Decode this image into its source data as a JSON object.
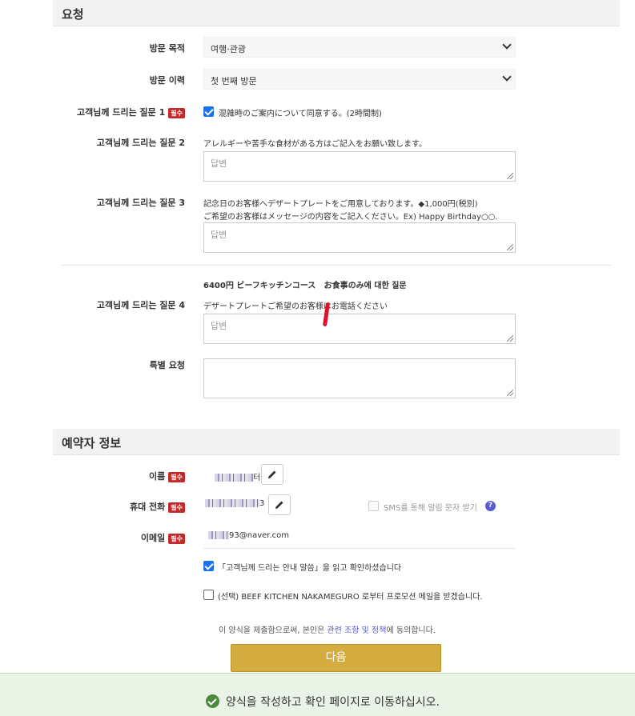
{
  "request_section": {
    "title": "요청",
    "visit_purpose": {
      "label": "방문 목적",
      "value": "여행·관광"
    },
    "visit_history": {
      "label": "방문 이력",
      "value": "첫 번째 방문"
    },
    "q1": {
      "label": "고객님께 드리는 질문 1",
      "required": "필수",
      "text": "混雑時のご案内について同意する。(2時間制)",
      "checked": true
    },
    "q2": {
      "label": "고객님께 드리는 질문 2",
      "text": "アレルギーや苦手な食材がある方はご記入をお願い致します。",
      "placeholder": "답변"
    },
    "q3": {
      "label": "고객님께 드리는 질문 3",
      "text_line1": "記念日のお客様へデザートプレートをご用意しております。◆1,000円(税別)",
      "text_line2": "ご希望のお客様はメッセージの内容をご記入ください。Ex) Happy Birthday○○.",
      "placeholder": "답변"
    },
    "course_heading_prefix": "6400円 ビーフキッチンコース",
    "course_heading_suffix": "お食事のみ에 대한 질문",
    "q4": {
      "label": "고객님께 드리는 질문 4",
      "text": "デザートプレートご希望のお客様はお電話ください",
      "placeholder": "답변"
    },
    "special": {
      "label": "특별 요청",
      "placeholder": ""
    }
  },
  "booker_section": {
    "title": "예약자 정보",
    "name": {
      "label": "이름",
      "required": "필수",
      "value_suffix": "터"
    },
    "phone": {
      "label": "휴대 전화",
      "required": "필수",
      "value_suffix": "3"
    },
    "sms_label": "SMS를 통해 알림 문자 받기",
    "help_glyph": "?",
    "email": {
      "label": "이메일",
      "required": "필수",
      "value_suffix": "93@naver.com"
    },
    "confirm_text": "「고객님께 드리는 안내 말씀」을 읽고 확인하셨습니다",
    "promo_text": "(선택) BEEF KITCHEN NAKAMEGURO 로부터 프로모션 메일을 받겠습니다.",
    "consent_prefix": "이 양식을 제출함으로써, 본인은 ",
    "consent_link": "관련 조항 및 정책",
    "consent_suffix": "에 동의합니다."
  },
  "next_button": "다음",
  "notice_text": "양식을 작성하고 확인 페이지로 이동하십시오.",
  "colors": {
    "accent_button": "#d4ac3f",
    "required_badge": "#c62828",
    "checkbox": "#1a73e8",
    "notice_bg": "#e9f4e6",
    "link": "#5b5bd6"
  }
}
